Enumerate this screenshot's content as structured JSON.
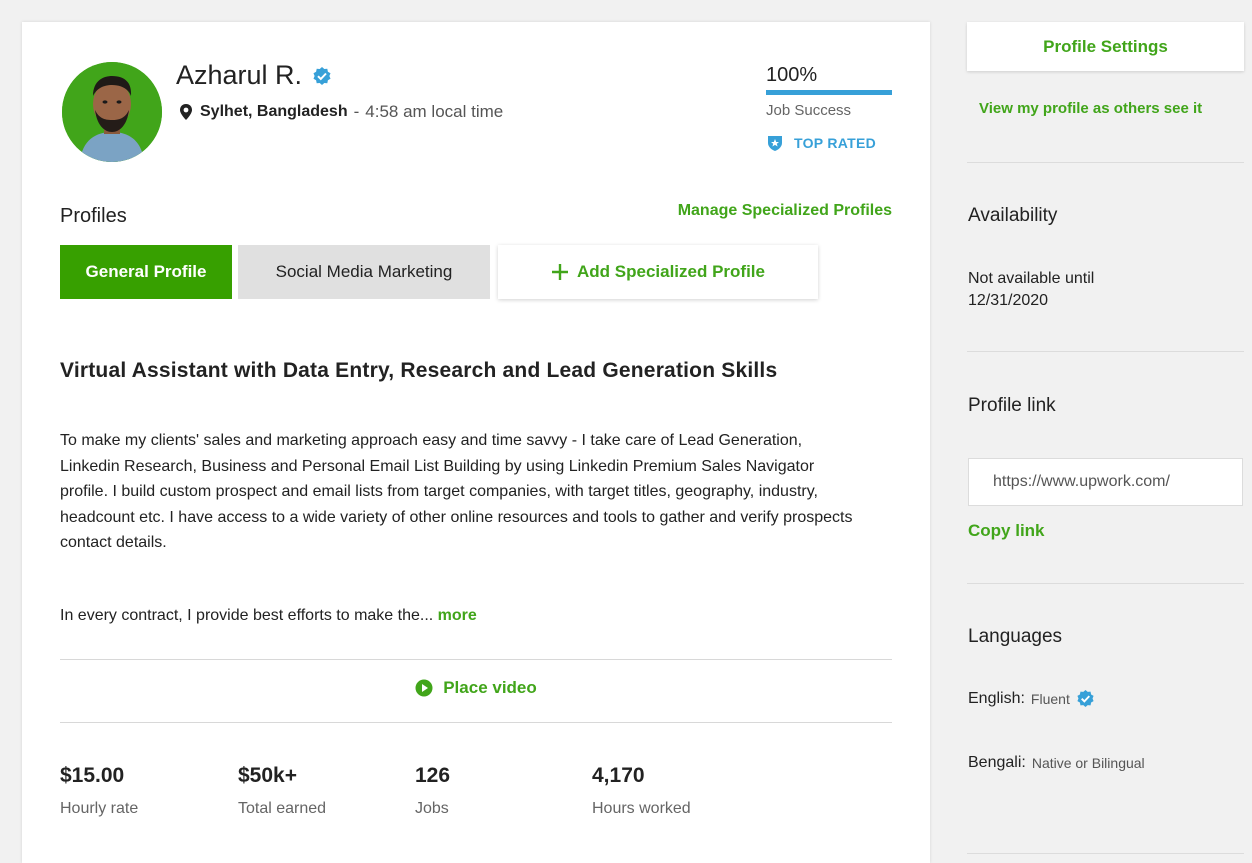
{
  "profile": {
    "name": "Azharul R.",
    "location": "Sylhet, Bangladesh",
    "separator": "-",
    "local_time": "4:58 am local time",
    "job_success_pct": "100%",
    "job_success_fraction": 1.0,
    "job_success_label": "Job Success",
    "badge": "TOP RATED"
  },
  "profiles": {
    "heading": "Profiles",
    "manage_link": "Manage Specialized Profiles",
    "tabs": [
      {
        "label": "General Profile"
      },
      {
        "label": "Social Media Marketing"
      },
      {
        "label": "Add Specialized Profile"
      }
    ]
  },
  "content": {
    "headline": "Virtual Assistant with Data Entry, Research and Lead Generation Skills",
    "description": "To make my clients' sales and marketing approach easy and time savvy - I take care of Lead Generation, Linkedin Research, Business and Personal Email List Building by using Linkedin Premium Sales Navigator profile. I build custom prospect and email lists from target companies, with target titles, geography, industry, headcount etc. I have access to a wide variety of other online resources and tools to gather and verify prospects contact details.",
    "contract_text": "In every contract, I provide best efforts to make the...",
    "more": "more",
    "place_video": "Place video"
  },
  "stats": [
    {
      "value": "$15.00",
      "label": "Hourly rate"
    },
    {
      "value": "$50k+",
      "label": "Total earned"
    },
    {
      "value": "126",
      "label": "Jobs"
    },
    {
      "value": "4,170",
      "label": "Hours worked"
    }
  ],
  "sidebar": {
    "settings_button": "Profile Settings",
    "view_as_others": "View my profile as others see it",
    "availability_heading": "Availability",
    "availability_text": "Not available until 12/31/2020",
    "profile_link_heading": "Profile link",
    "profile_link_value": "https://www.upwork.com/",
    "copy_link": "Copy link",
    "languages_heading": "Languages",
    "languages": [
      {
        "name": "English:",
        "level": "Fluent",
        "verified": true
      },
      {
        "name": "Bengali:",
        "level": "Native or Bilingual",
        "verified": false
      }
    ]
  },
  "colors": {
    "brand_green": "#37a000",
    "link_green": "#41a51a",
    "accent_blue": "#37a0d8"
  },
  "icons": [
    "verified-badge-icon",
    "map-pin-icon",
    "shield-icon",
    "plus-icon",
    "play-circle-icon",
    "user-avatar"
  ]
}
